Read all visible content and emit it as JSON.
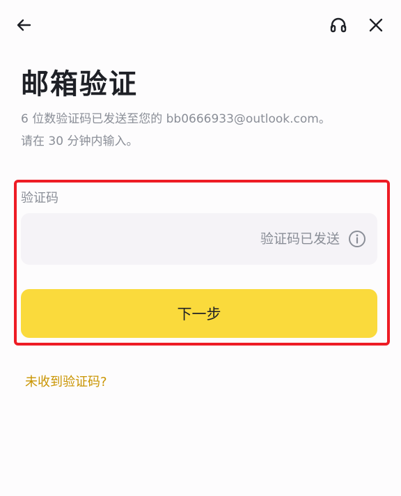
{
  "header": {
    "back_icon": "arrow-left-icon",
    "support_icon": "headset-icon",
    "close_icon": "close-icon"
  },
  "page": {
    "title": "邮箱验证",
    "subtitle_line1": "6 位数验证码已发送至您的 bb0666933@outlook.com。",
    "subtitle_line2": "请在 30 分钟内输入。"
  },
  "form": {
    "code_label": "验证码",
    "code_value": "",
    "code_status": "验证码已发送",
    "info_icon": "info-circle-icon",
    "next_label": "下一步"
  },
  "links": {
    "resend": "未收到验证码?"
  },
  "colors": {
    "primary_yellow": "#fada3c",
    "link_gold": "#c99400",
    "highlight_red": "#ee1c25",
    "input_bg": "#f5f3f7",
    "muted_text": "#8a8e97"
  }
}
